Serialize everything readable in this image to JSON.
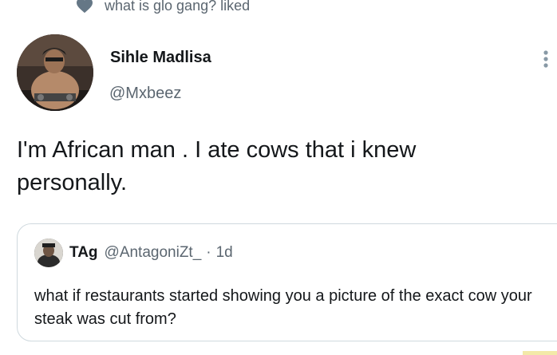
{
  "liked_banner": {
    "text": "what is glo gang? liked",
    "icon": "heart-icon"
  },
  "tweet": {
    "author_name": "Sihle Madlisa",
    "author_handle": "@Mxbeez",
    "text": "I'm African man . I ate cows that i knew personally.",
    "more_icon": "vertical-ellipsis-icon"
  },
  "quoted_tweet": {
    "author_name": "TAg",
    "author_handle": "@AntagoniZt_",
    "separator": "·",
    "time": "1d",
    "text": "what if restaurants started showing you a picture of the exact cow your steak was cut from?"
  },
  "colors": {
    "primary_text": "#14171a",
    "secondary_text": "#5b6670",
    "border": "#cfd9de"
  }
}
